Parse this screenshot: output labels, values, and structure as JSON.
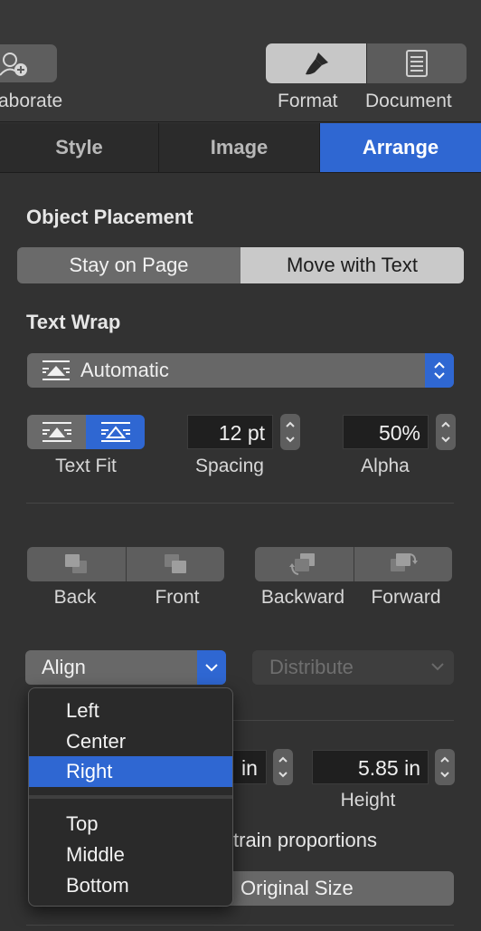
{
  "toolbar": {
    "collaborate_label": "aborate",
    "format_label": "Format",
    "document_label": "Document"
  },
  "tabs": [
    {
      "label": "Style",
      "active": false
    },
    {
      "label": "Image",
      "active": false
    },
    {
      "label": "Arrange",
      "active": true
    }
  ],
  "object_placement": {
    "title": "Object Placement",
    "options": [
      "Stay on Page",
      "Move with Text"
    ],
    "selected": "Move with Text"
  },
  "text_wrap": {
    "title": "Text Wrap",
    "value": "Automatic",
    "text_fit_label": "Text Fit",
    "spacing_value": "12 pt",
    "spacing_label": "Spacing",
    "alpha_value": "50%",
    "alpha_label": "Alpha"
  },
  "layering": {
    "back_label": "Back",
    "front_label": "Front",
    "backward_label": "Backward",
    "forward_label": "Forward"
  },
  "align": {
    "label": "Align",
    "distribute_label": "Distribute",
    "menu_items": [
      "Left",
      "Center",
      "Right",
      "Top",
      "Middle",
      "Bottom"
    ],
    "selected_item": "Right"
  },
  "size": {
    "width_partial": "in",
    "height_value": "5.85 in",
    "height_label": "Height",
    "constrain_partial": "train proportions",
    "original_size_label": "Original Size"
  },
  "colors": {
    "accent": "#2f67d2",
    "panel": "#323232"
  }
}
